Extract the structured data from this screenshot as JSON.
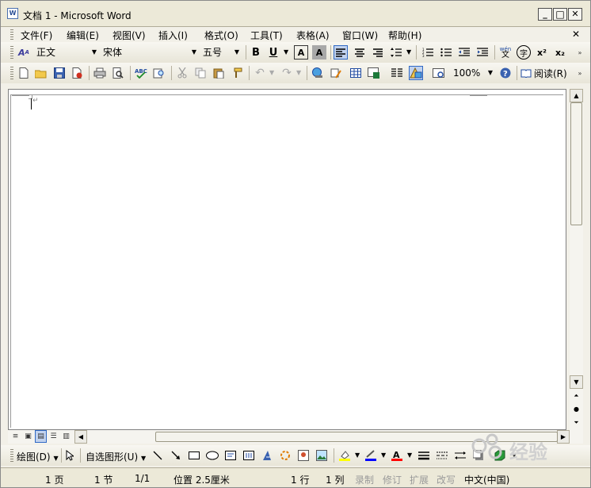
{
  "window": {
    "title": "文档 1 - Microsoft Word",
    "app_icon_text": "W",
    "controls": {
      "minimize": "_",
      "maximize": "□",
      "close": "✕"
    }
  },
  "menubar": {
    "items": [
      {
        "label": "文件(F)"
      },
      {
        "label": "编辑(E)"
      },
      {
        "label": "视图(V)"
      },
      {
        "label": "插入(I)"
      },
      {
        "label": "格式(O)"
      },
      {
        "label": "工具(T)"
      },
      {
        "label": "表格(A)"
      },
      {
        "label": "窗口(W)"
      },
      {
        "label": "帮助(H)"
      }
    ],
    "close_doc": "✕"
  },
  "formatting_toolbar": {
    "style": "正文",
    "font": "宋体",
    "size": "五号",
    "bold": "B",
    "underline": "U",
    "char_border": "A",
    "char_shading": "A",
    "superscript": "x²",
    "subscript": "x₂",
    "phonetic": "wén",
    "enclose": "字"
  },
  "standard_toolbar": {
    "zoom": "100%",
    "read_label": "阅读(R)"
  },
  "drawing_toolbar": {
    "draw_label": "绘图(D)",
    "autoshapes_label": "自选图形(U)"
  },
  "statusbar": {
    "page": "1 页",
    "section": "1 节",
    "page_of": "1/1",
    "position": "位置 2.5厘米",
    "line": "1 行",
    "column": "1 列",
    "rec": "录制",
    "trk": "修订",
    "ext": "扩展",
    "ovr": "改写",
    "language": "中文(中国)"
  },
  "watermark": {
    "text": "经验"
  },
  "colors": {
    "highlight": "#ffff00",
    "font_color": "#ff0000",
    "line_color": "#0000ff"
  }
}
